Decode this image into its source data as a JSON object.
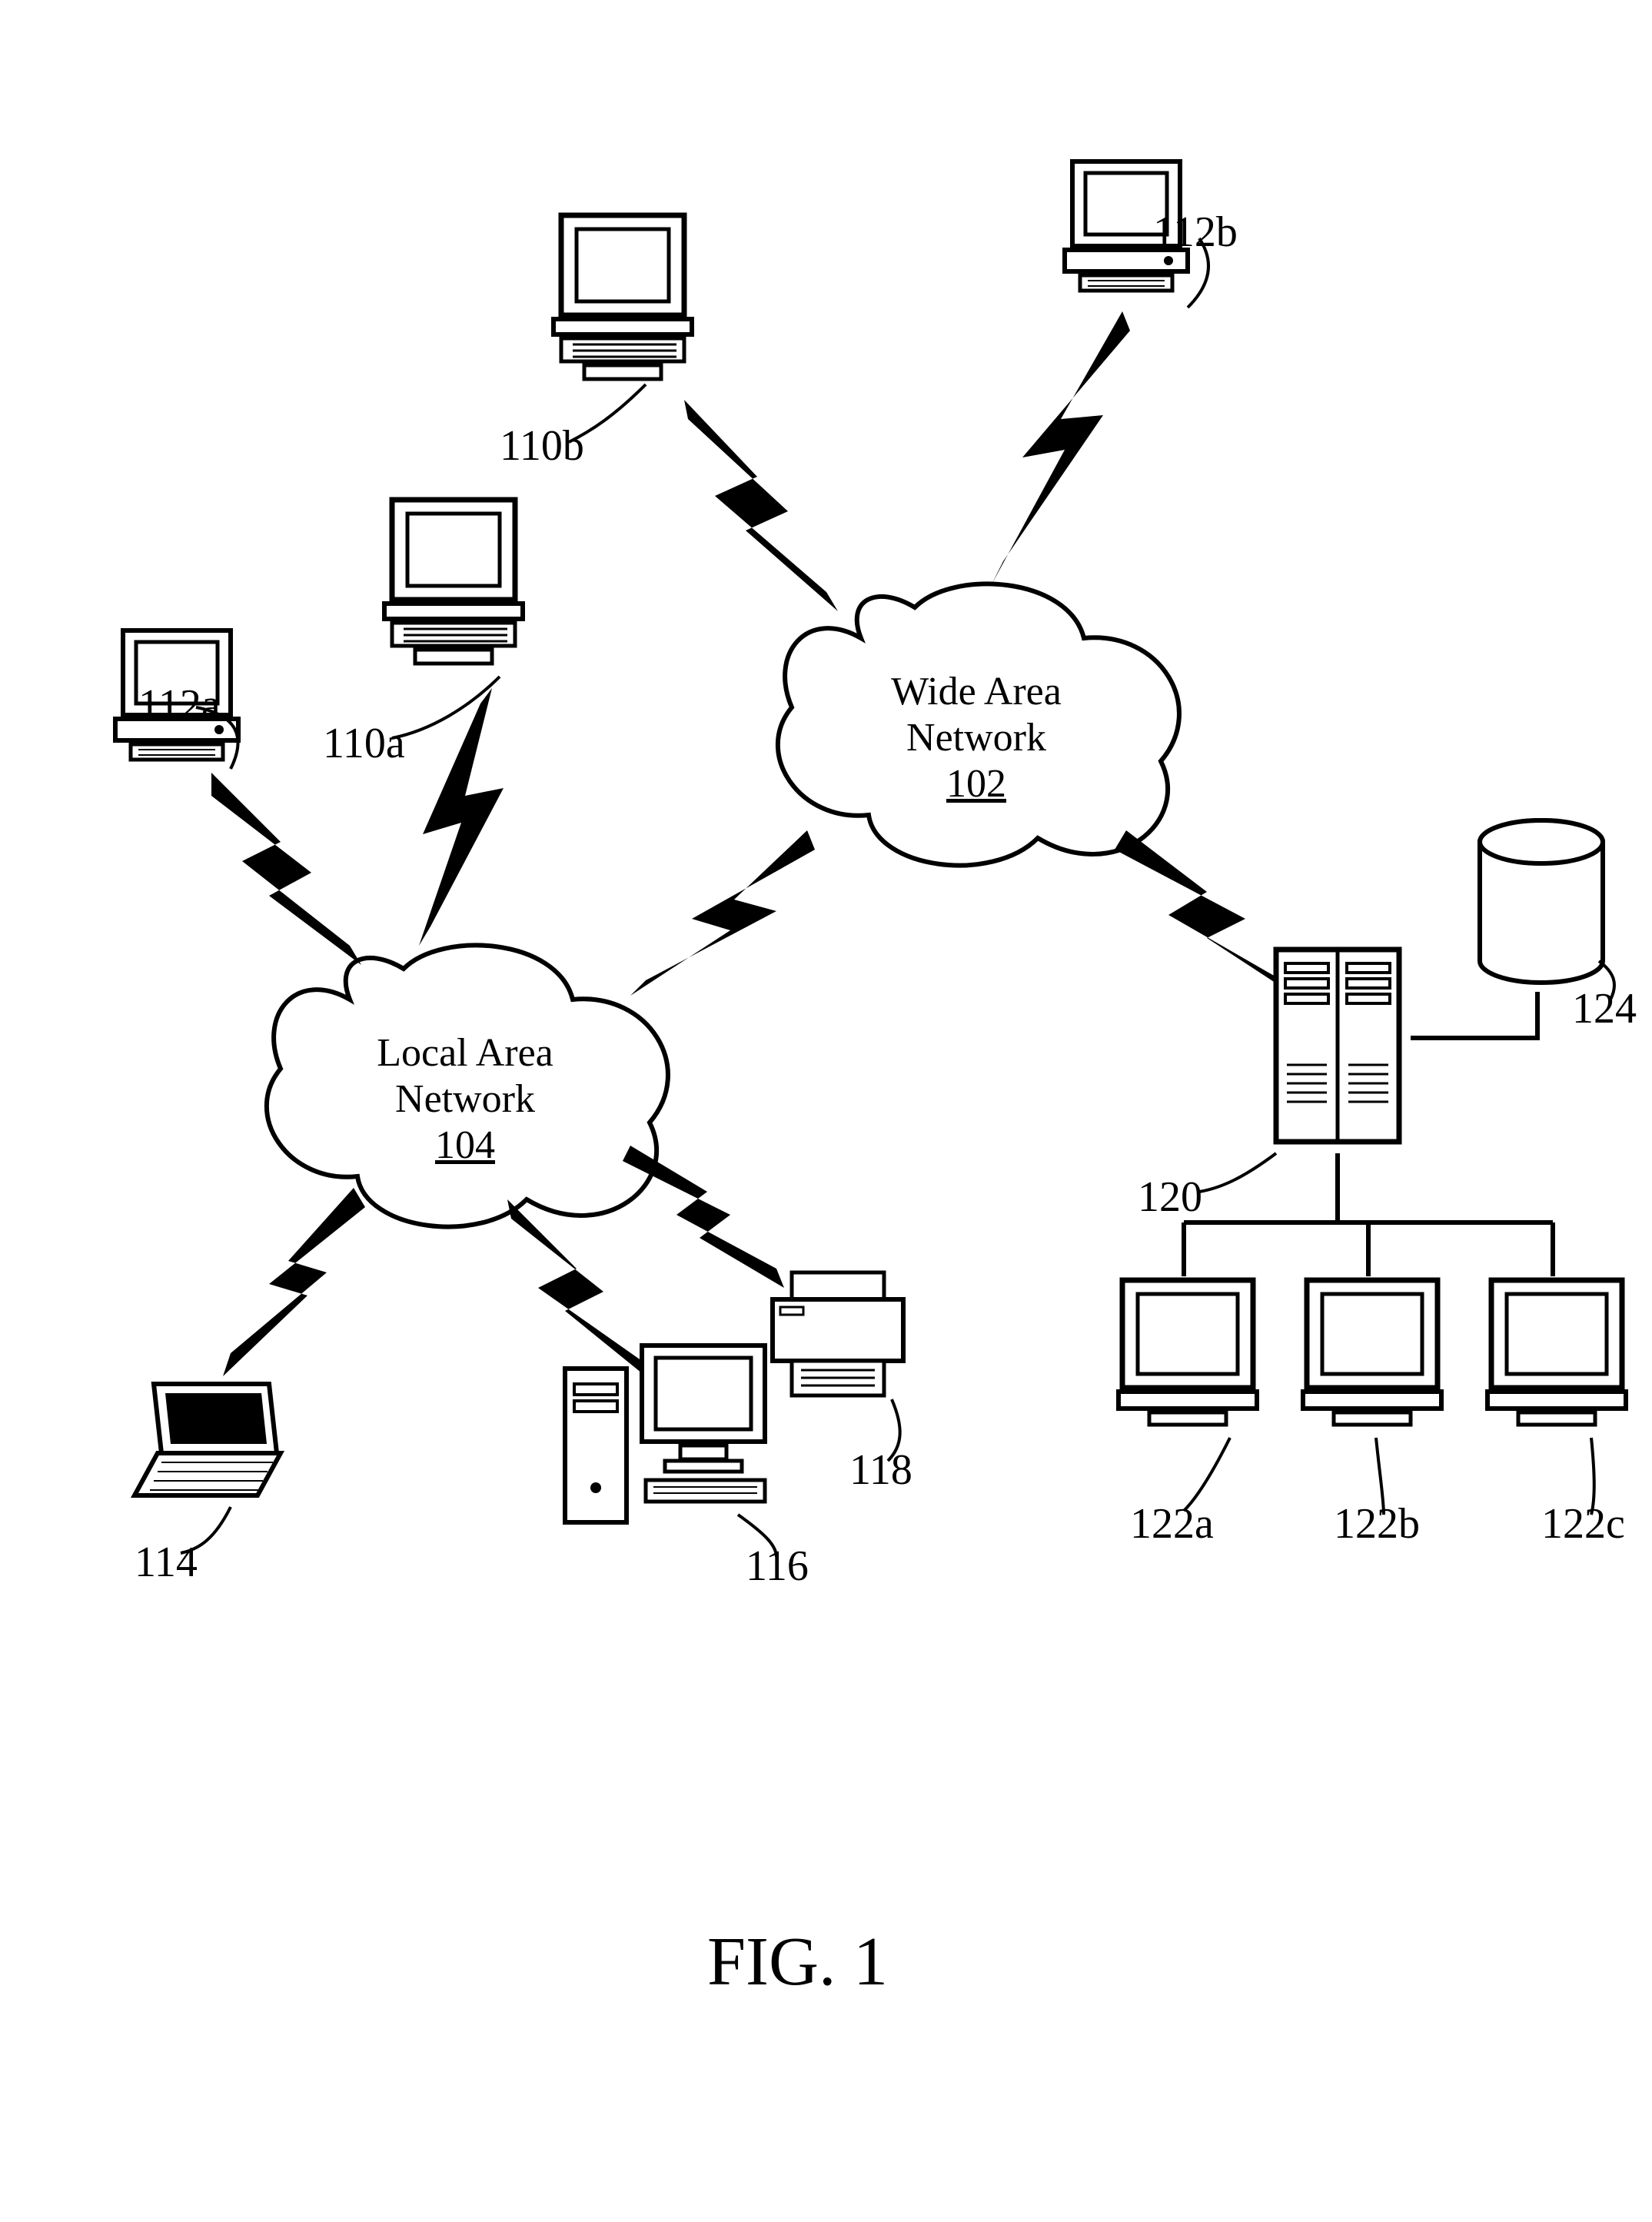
{
  "figure_caption": "FIG. 1",
  "clouds": {
    "wan": {
      "title": "Wide Area Network",
      "ref": "102"
    },
    "lan": {
      "title": "Local Area Network",
      "ref": "104"
    }
  },
  "labels": {
    "w110a": "110a",
    "w110b": "110b",
    "w112a": "112a",
    "w112b": "112b",
    "w114": "114",
    "w116": "116",
    "w118": "118",
    "w120": "120",
    "w122a": "122a",
    "w122b": "122b",
    "w122c": "122c",
    "w124": "124"
  }
}
